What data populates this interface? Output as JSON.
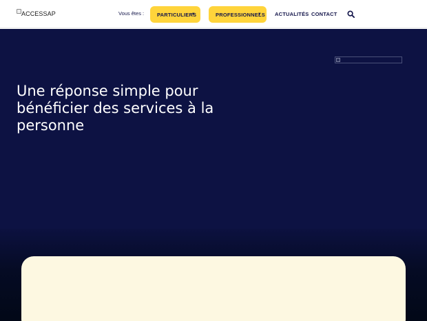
{
  "header": {
    "logo_alt": "ACCESSAP",
    "vous_etes": "Vous êtes :",
    "nav": {
      "particuliers": "PARTICULIERS",
      "professionnels": "PROFESSIONNELS",
      "actualites": "ACTUALITÉS",
      "contact": "CONTACT"
    },
    "caret": "▼"
  },
  "hero": {
    "title": "Une réponse simple pour bénéficier des services à la personne"
  },
  "colors": {
    "accent": "#ffd43b",
    "hero_bg": "#0d1243",
    "text_dark": "#13154a",
    "card_bg": "#fdf8e1"
  },
  "icons": {
    "search": "search-icon",
    "logo": "broken-image-icon"
  }
}
